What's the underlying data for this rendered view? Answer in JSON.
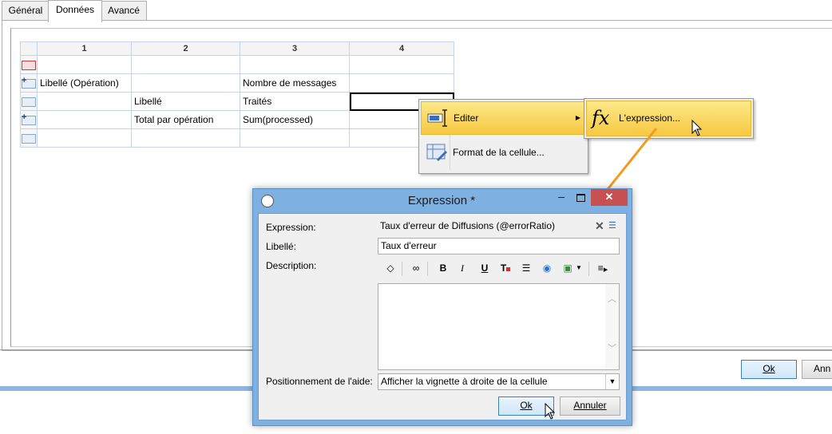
{
  "tabs": [
    {
      "label": "Général"
    },
    {
      "label": "Données"
    },
    {
      "label": "Avancé"
    }
  ],
  "grid": {
    "columns": [
      "1",
      "2",
      "3",
      "4"
    ],
    "rows": [
      [
        "",
        "",
        "",
        ""
      ],
      [
        "Libellé (Opération)",
        "",
        "Nombre de messages",
        ""
      ],
      [
        "",
        "Libellé",
        "Traités",
        ""
      ],
      [
        "",
        "Total par opération",
        "Sum(processed)",
        ""
      ],
      [
        "",
        "",
        "",
        ""
      ]
    ]
  },
  "context_menu": {
    "items": [
      {
        "label": "Editer",
        "icon": "edit-icon"
      },
      {
        "label": "Format de la cellule...",
        "icon": "cell-format-icon"
      }
    ],
    "submenu": {
      "label": "L'expression...",
      "icon": "fx-icon"
    }
  },
  "background_buttons": {
    "ok": "Ok",
    "cancel": "Ann"
  },
  "dialog": {
    "title": "Expression *",
    "expression_label": "Expression:",
    "expression_value": "Taux d'erreur de Diffusions (@errorRatio)",
    "libelle_label": "Libellé:",
    "libelle_value": "Taux d'erreur",
    "description_label": "Description:",
    "help_label": "Positionnement de l'aide:",
    "help_value": "Afficher la vignette à droite de la cellule",
    "ok": "Ok",
    "cancel": "Annuler",
    "toolbar": [
      "source-icon",
      "find-icon",
      "B",
      "I",
      "U",
      "text-color-icon",
      "list-icon",
      "link-icon",
      "image-icon",
      "align-icon"
    ]
  },
  "colors": {
    "accent": "#7fb0e2",
    "highlight": "#f7c842",
    "arrow": "#f29a1c"
  }
}
